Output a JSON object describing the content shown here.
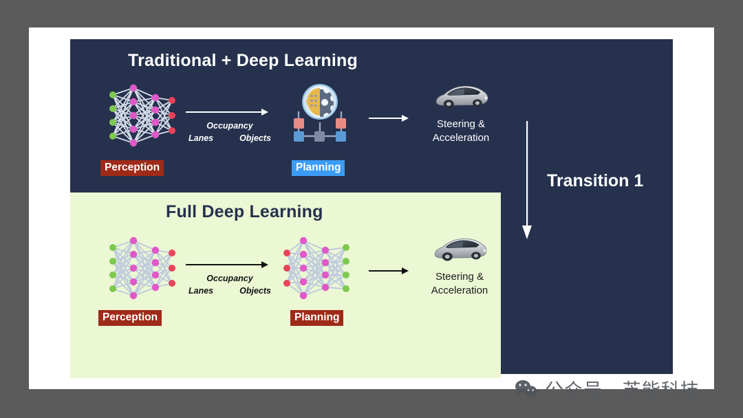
{
  "slide": {
    "background_color": "#5b5b5b",
    "frame_color": "#ffffff",
    "dark_panel_color": "#25314d",
    "green_panel_color": "#ecf7d4"
  },
  "sections": {
    "top": {
      "title": "Traditional + Deep Learning",
      "title_color": "#ffffff",
      "perception_tag": {
        "label": "Perception",
        "bg": "#9e2b18",
        "fg": "#ffffff"
      },
      "planning_tag": {
        "label": "Planning",
        "bg": "#3b9cf5",
        "fg": "#ffffff"
      },
      "arrow_labels": {
        "top": "Occupancy",
        "left": "Lanes",
        "right": "Objects"
      },
      "output_caption": "Steering &\nAcceleration",
      "output_caption_color": "#ffffff",
      "arrow_color": "#ffffff",
      "planning_icon": "brain-gear-network-icon",
      "perception_icon": "neural-network-icon",
      "car_icon": "sedan-car-icon"
    },
    "bottom": {
      "title": "Full Deep Learning",
      "title_color": "#25314d",
      "perception_tag": {
        "label": "Perception",
        "bg": "#9e2b18",
        "fg": "#ffffff"
      },
      "planning_tag": {
        "label": "Planning",
        "bg": "#9e2b18",
        "fg": "#ffffff"
      },
      "arrow_labels": {
        "top": "Occupancy",
        "left": "Lanes",
        "right": "Objects"
      },
      "output_caption": "Steering &\nAcceleration",
      "output_caption_color": "#1b1b1b",
      "arrow_color": "#111111",
      "perception_icon": "neural-network-icon",
      "planning_icon": "neural-network-icon",
      "car_icon": "sedan-car-icon"
    }
  },
  "transition": {
    "label": "Transition 1",
    "arrow_color": "#ffffff",
    "arrow_direction": "down",
    "icon": "down-arrow-icon"
  },
  "watermark": {
    "text": "公众号 · 芝能科技",
    "icon": "wechat-icon",
    "color": "#555a60"
  },
  "palette": {
    "node_green": "#7ec850",
    "node_pink": "#e158c8",
    "node_red": "#e8445a",
    "edge_light": "#cfd8ea",
    "edge_dark_bg": "#e4eaf4"
  }
}
